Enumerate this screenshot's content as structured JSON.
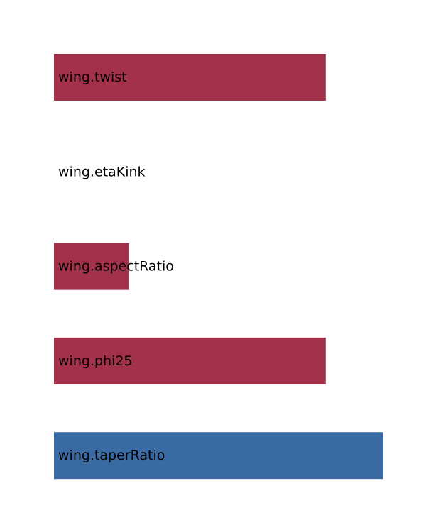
{
  "chart_data": {
    "type": "bar",
    "orientation": "horizontal",
    "categories": [
      "wing.twist",
      "wing.etaKink",
      "wing.aspectRatio",
      "wing.phi25",
      "wing.taperRatio"
    ],
    "values": [
      0.825,
      0.0,
      0.228,
      0.825,
      1.0
    ],
    "bar_colors": [
      "#a23149",
      "#a23149",
      "#a23149",
      "#a23149",
      "#3b6ba5"
    ],
    "xlim": [
      0,
      1
    ],
    "title": "",
    "xlabel": "",
    "ylabel": "",
    "grid": false
  }
}
